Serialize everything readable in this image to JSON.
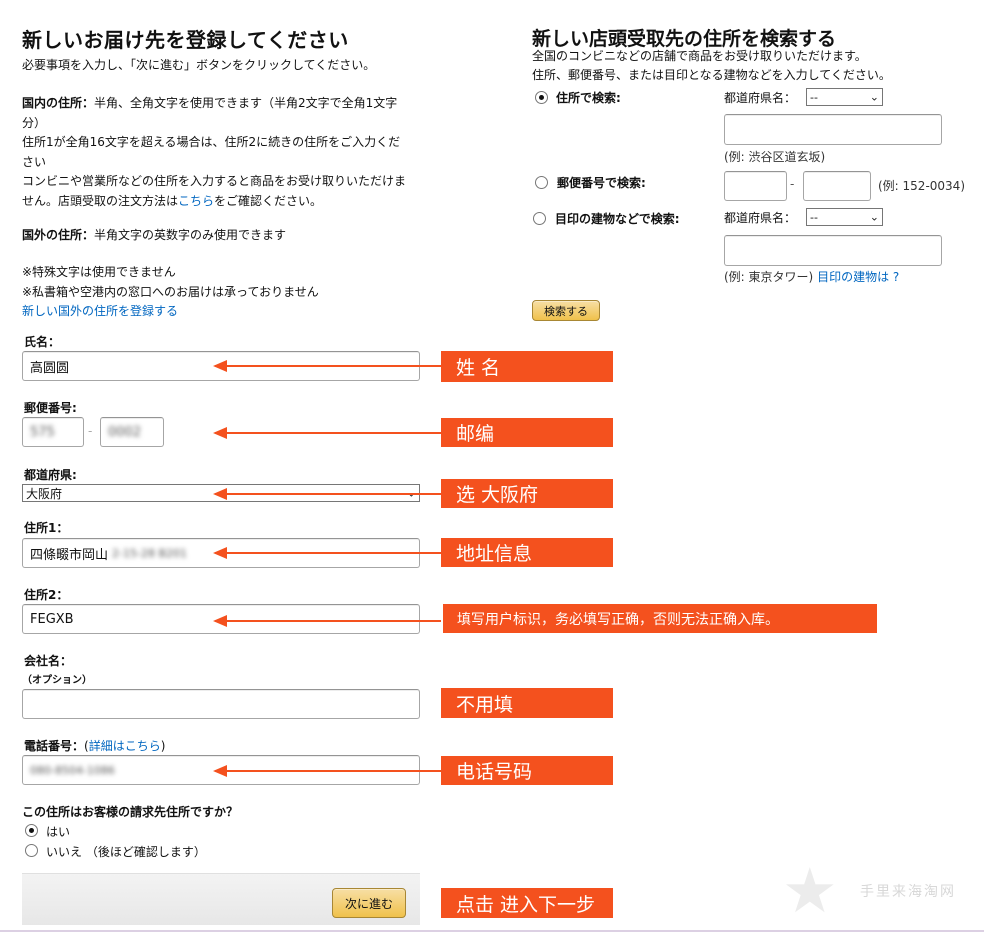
{
  "left": {
    "title": "新しいお届け先を登録してください",
    "intro": "必要事項を入力し、「次に進む」ボタンをクリックしてください。",
    "domestic_label": "国内の住所：",
    "domestic_line1": "半角、全角文字を使用できます（半角2文字で全角1文字",
    "domestic_line2": "分）",
    "domestic_line3": "住所1が全角16文字を超える場合は、住所2に続きの住所をご入力くだ",
    "domestic_line4": "さい",
    "domestic_line5": "コンビニや営業所などの住所を入力すると商品をお受け取りいただけま",
    "domestic_line6_pre": "せん。店頭受取の注文方法は",
    "domestic_line6_link": "こちら",
    "domestic_line6_post": "をご確認ください。",
    "foreign_label": "国外の住所：",
    "foreign_text": "半角文字の英数字のみ使用できます",
    "note1": "※特殊文字は使用できません",
    "note2": "※私書箱や空港内の窓口へのお届けは承っておりません",
    "foreign_link": "新しい国外の住所を登録する"
  },
  "form": {
    "name_label": "氏名：",
    "name_value": "高圆圆",
    "postal_label": "郵便番号:",
    "postal_value1": "575",
    "postal_dash": "-",
    "postal_value2": "0002",
    "prefecture_label": "都道府県:",
    "prefecture_value": "大阪府",
    "addr1_label": "住所1：",
    "addr1_value": "四條畷市岡山",
    "addr1_blurred": "2-15-28 B201",
    "addr2_label": "住所2：",
    "addr2_value": "FEGXB",
    "company_label": "会社名：",
    "company_optional": "（オプション）",
    "company_value": "",
    "phone_label": "電話番号：",
    "phone_link_open": "(",
    "phone_link": "詳細はこちら",
    "phone_link_close": ")",
    "phone_value": "080-8504-1086",
    "billing_question": "この住所はお客様の請求先住所ですか？",
    "billing_yes": "はい",
    "billing_no": "いいえ （後ほど確認します）",
    "next_button": "次に進む"
  },
  "right": {
    "title": "新しい店頭受取先の住所を検索する",
    "desc1": "全国のコンビニなどの店舗で商品をお受け取りいただけます。",
    "desc2": "住所、郵便番号、または目印となる建物などを入力してください。",
    "opt_address": "住所で検索:",
    "opt_postal": "郵便番号で検索:",
    "opt_landmark": "目印の建物などで検索:",
    "pref_label": "都道府県名：",
    "pref_label2": "都道府県名：",
    "pref_select": "--",
    "pref_select2": "--",
    "example_address": "(例: 渋谷区道玄坂)",
    "postal_dash": "-",
    "example_postal": "(例: 152-0034)",
    "example_landmark": "(例: 東京タワー)",
    "landmark_link": "目印の建物は ?",
    "search_button": "検索する"
  },
  "annotations": {
    "name": "姓 名",
    "postal": "邮编",
    "prefecture": "选 大阪府",
    "addr1": "地址信息",
    "addr2": "填写用户标识，务必填写正确，否则无法正确入库。",
    "company": "不用填",
    "phone": "电话号码",
    "next": "点击 进入下一步"
  },
  "watermark": "手里来海淘网",
  "colors": {
    "annotation": "#f4511e",
    "link": "#0066c0",
    "button_top": "#f7dfa5",
    "button_bottom": "#f0c14b"
  }
}
